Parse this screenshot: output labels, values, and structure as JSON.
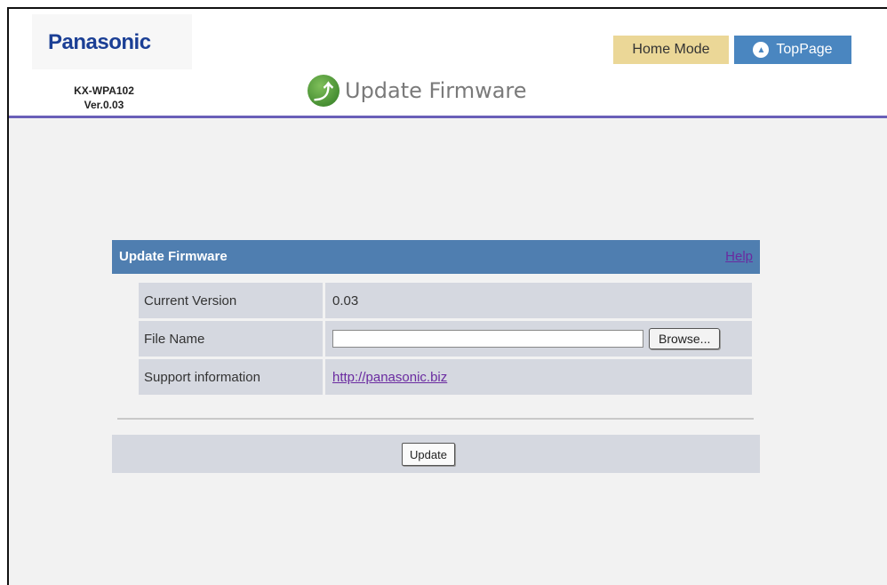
{
  "header": {
    "logo": "Panasonic",
    "model": "KX-WPA102",
    "version": "Ver.0.03",
    "page_title": "Update Firmware",
    "home_mode_label": "Home Mode",
    "toppage_label": "TopPage"
  },
  "panel": {
    "title": "Update Firmware",
    "help_label": "Help",
    "rows": [
      {
        "label": "Current Version",
        "value": "0.03"
      },
      {
        "label": "File Name",
        "value": ""
      },
      {
        "label": "Support information",
        "value": "http://panasonic.biz"
      }
    ],
    "browse_label": "Browse...",
    "update_label": "Update"
  },
  "colors": {
    "brand": "#1b3f95",
    "panel_header": "#4f7eb0",
    "home_mode_bg": "#ebd797",
    "toppage_bg": "#4a86c0",
    "link": "#6a2aa0"
  },
  "icons": {
    "title_icon": "update-arrow-icon",
    "toppage_icon": "up-arrow-icon"
  }
}
